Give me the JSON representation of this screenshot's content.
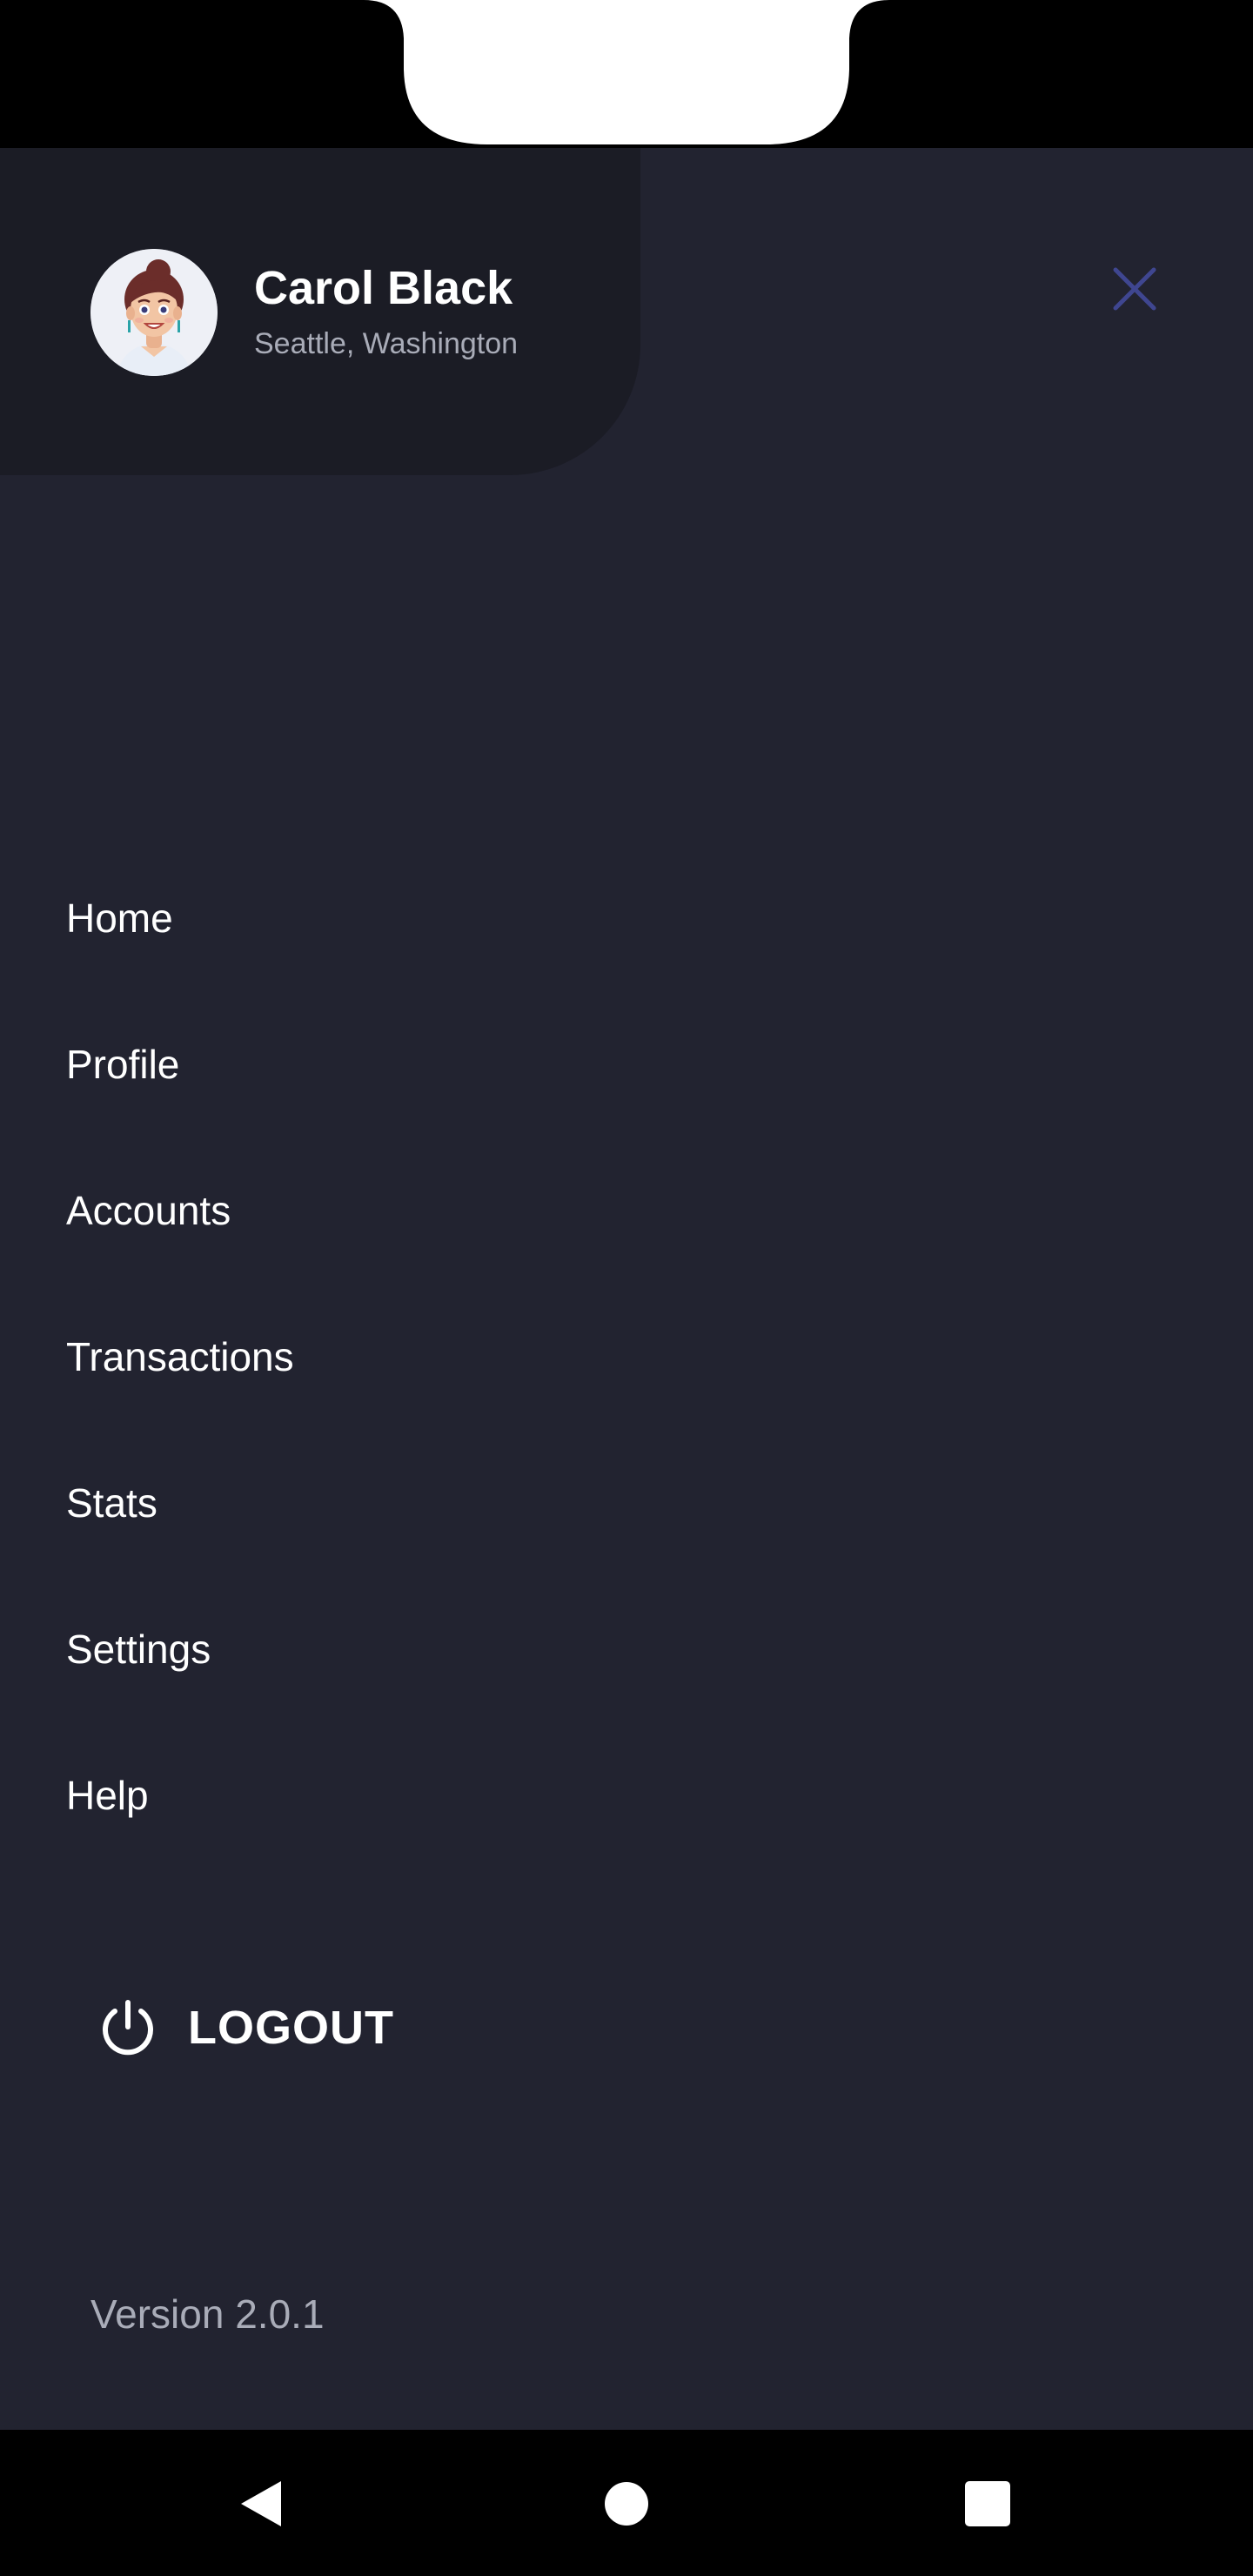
{
  "user": {
    "name": "Carol Black",
    "location": "Seattle, Washington"
  },
  "icons": {
    "close": "close-icon",
    "logout": "power-icon",
    "back": "back-triangle-icon",
    "home": "home-circle-icon",
    "recents": "recents-square-icon"
  },
  "menu": {
    "items": [
      {
        "label": "Home"
      },
      {
        "label": "Profile"
      },
      {
        "label": "Accounts"
      },
      {
        "label": "Transactions"
      },
      {
        "label": "Stats"
      },
      {
        "label": "Settings"
      },
      {
        "label": "Help"
      }
    ]
  },
  "logout": {
    "label": "LOGOUT"
  },
  "footer": {
    "version": "Version 2.0.1"
  },
  "colors": {
    "background": "#222330",
    "profile_card": "#1b1c25",
    "close_icon": "#3f4690",
    "text_primary": "#ffffff",
    "text_secondary": "#a9acb8"
  }
}
